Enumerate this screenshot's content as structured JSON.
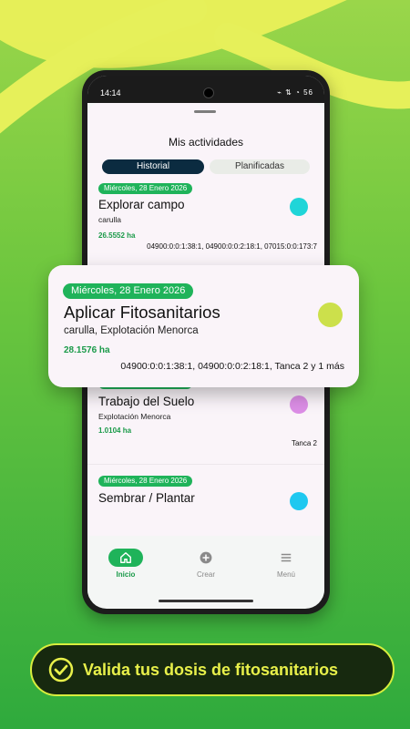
{
  "statusbar": {
    "time": "14:14",
    "icons": "⌁ ⇅ ◔ 56"
  },
  "screen_title": "Mis actividades",
  "tabs": [
    {
      "label": "Historial"
    },
    {
      "label": "Planificadas"
    }
  ],
  "activities": [
    {
      "date": "Miércoles, 28 Enero 2026",
      "title": "Explorar campo",
      "subtitle": "carulla",
      "area": "26.5552 ha",
      "ids": "04900:0:0:1:38:1, 04900:0:0:2:18:1, 07015:0:0:173:7",
      "color": "#1fd5d8"
    },
    {
      "date": "Miércoles, 28 Enero 2026",
      "title": "Aplicar Fitosanitarios",
      "subtitle": "carulla, Explotación Menorca",
      "area": "28.1576 ha",
      "ids": "04900:0:0:1:38:1, 04900:0:0:2:18:1, Tanca 2 y 1 más",
      "color": "#cce04b"
    },
    {
      "date": "Miércoles, 28 Enero 2026",
      "title": "Trabajo del Suelo",
      "subtitle": "Explotación Menorca",
      "area": "1.0104 ha",
      "ids": "Tanca 2",
      "color": "#dc8ee6"
    },
    {
      "date": "Miércoles, 28 Enero 2026",
      "title": "Sembrar / Plantar",
      "subtitle": "",
      "area": "",
      "ids": "",
      "color": "#1fc8f0"
    }
  ],
  "nav": [
    {
      "label": "Inicio",
      "icon": "home-icon"
    },
    {
      "label": "Crear",
      "icon": "add-icon"
    },
    {
      "label": "Menú",
      "icon": "menu-icon"
    }
  ],
  "banner": {
    "text": "Valida tus dosis de fitosanitarios",
    "icon": "check-circle-icon"
  },
  "colors": {
    "accent": "#1fb35a",
    "dark_tab": "#0b2b40",
    "banner_bg": "#17290f",
    "banner_text": "#e8f04a"
  }
}
